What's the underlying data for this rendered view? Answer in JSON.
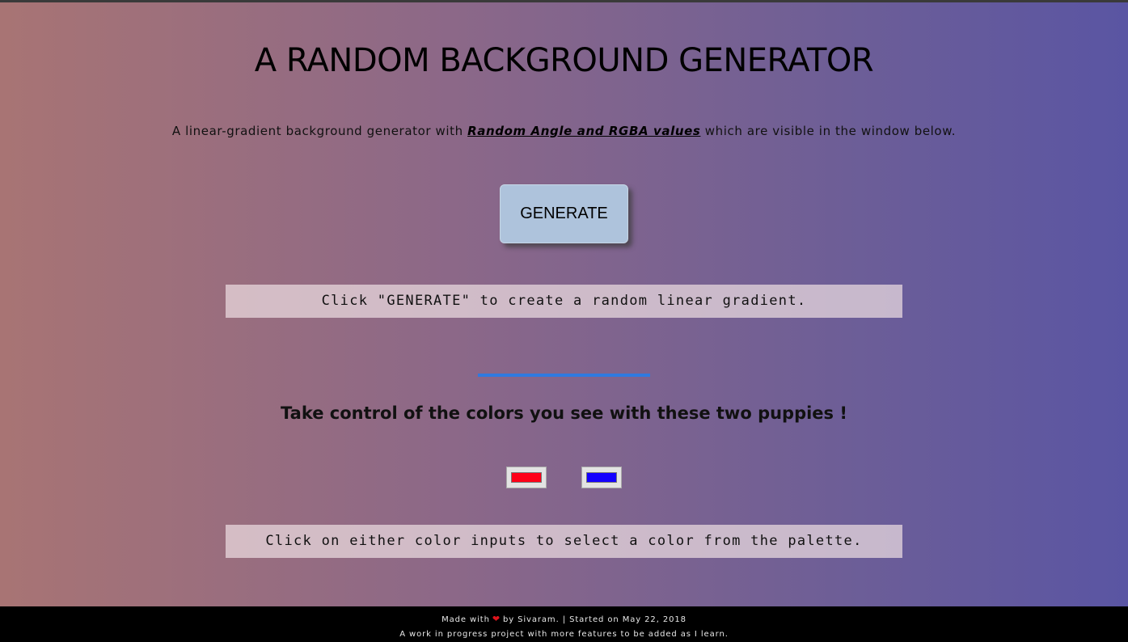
{
  "page": {
    "title": "A RANDOM BACKGROUND GENERATOR",
    "subtitle_before": "A linear-gradient background generator with ",
    "subtitle_emphasis": "Random Angle and RGBA values",
    "subtitle_after": " which are visible in the window below."
  },
  "generate_button": {
    "label": "GENERATE"
  },
  "info": {
    "generate_hint": "Click \"GENERATE\" to create a random linear gradient.",
    "palette_hint": "Click on either color inputs to select a color from the palette."
  },
  "controls": {
    "heading": "Take control of the colors you see with these two puppies !",
    "color_1": "#ff0018",
    "color_2": "#1400ff"
  },
  "footer": {
    "made_with": "Made with",
    "by_line": "by Sivaram. | Started on May 22, 2018",
    "wip_note": "A work in progress project with more features to be added as I learn.",
    "heart_icon": "heart-icon",
    "heart_color": "#e0141c"
  },
  "colors": {
    "gradient_left": "#a87474",
    "gradient_right": "#5a55a3",
    "divider": "#2f7ae0",
    "button_bg": "#aec3dc"
  }
}
